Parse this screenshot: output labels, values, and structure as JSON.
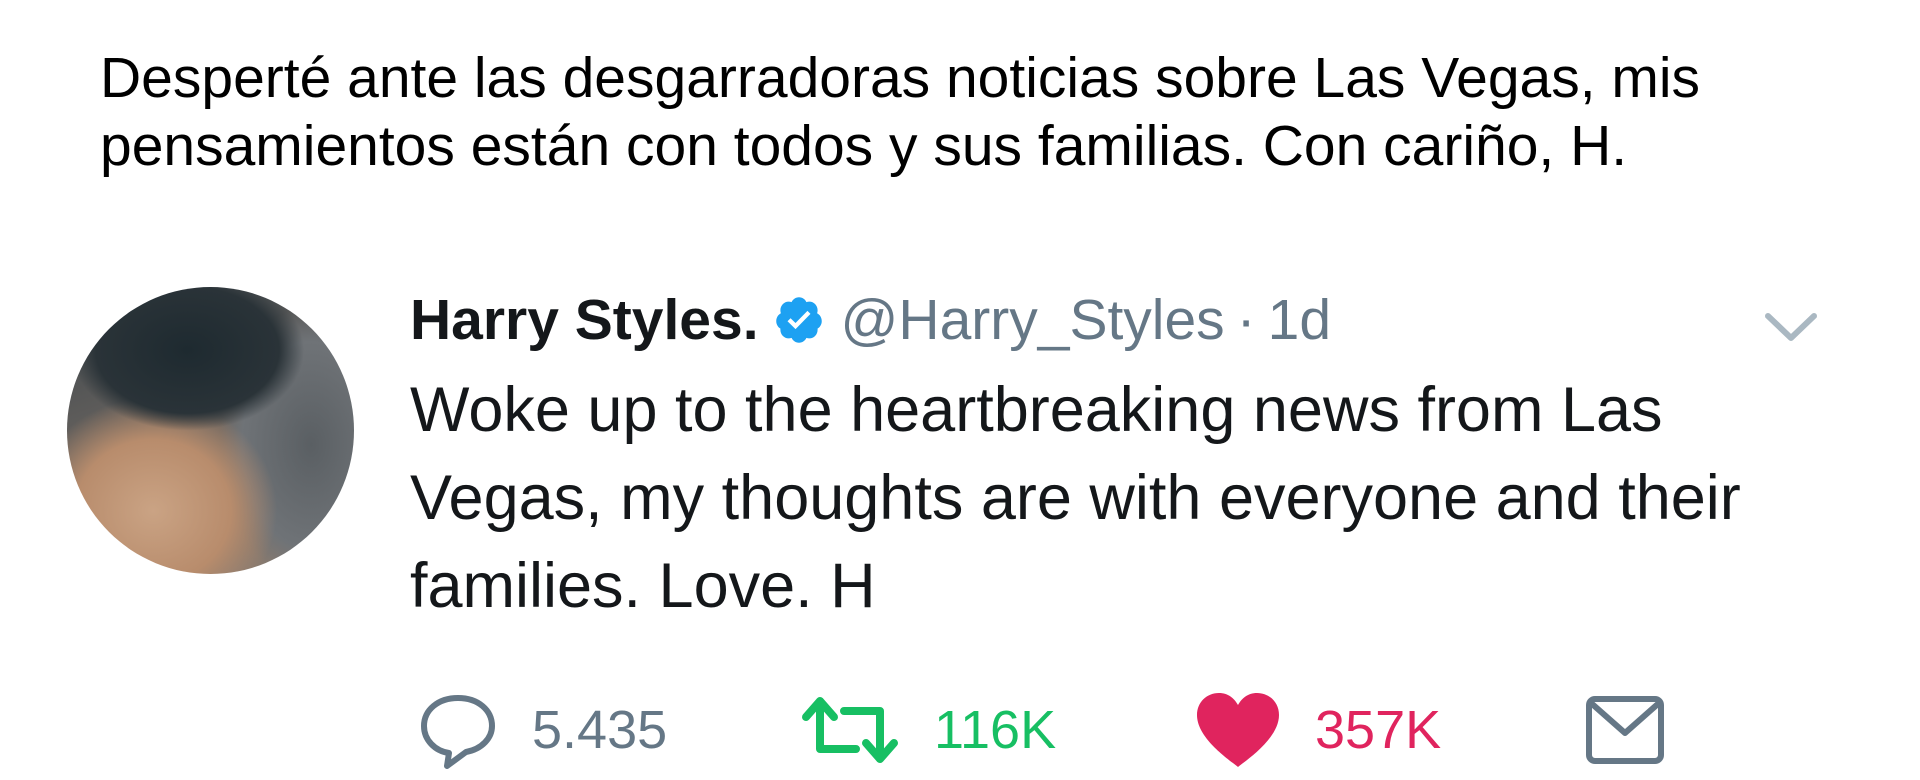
{
  "translation": {
    "text": "Desperté ante las desgarradoras noticias sobre Las Vegas, mis pensamientos están con todos y sus familias. Con cariño, H."
  },
  "tweet": {
    "display_name": "Harry Styles.",
    "handle": "@Harry_Styles",
    "separator": "·",
    "time": "1d",
    "text": "Woke up to the heartbreaking news from Las Vegas, my thoughts are with everyone and their families. Love. H",
    "icons": {
      "verified": "verified-badge-icon",
      "caret": "chevron-down-icon",
      "reply": "reply-icon",
      "retweet": "retweet-icon",
      "like": "heart-icon",
      "dm": "envelope-icon"
    },
    "actions": {
      "replies": "5.435",
      "retweets": "116K",
      "likes": "357K"
    }
  },
  "colors": {
    "verified_blue": "#1da1f2",
    "retweet_green": "#17bf63",
    "like_red": "#e0245e",
    "muted_gray": "#657786"
  }
}
